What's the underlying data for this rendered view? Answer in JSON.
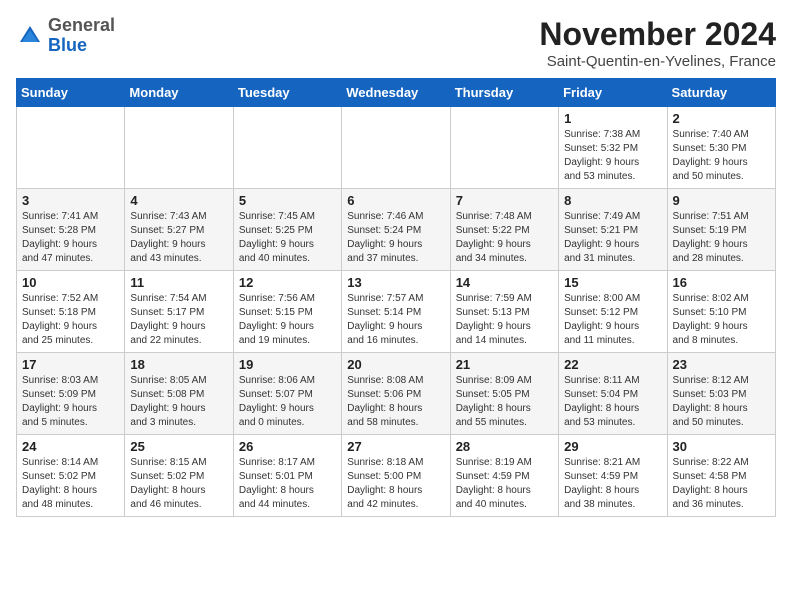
{
  "header": {
    "logo_general": "General",
    "logo_blue": "Blue",
    "month_year": "November 2024",
    "location": "Saint-Quentin-en-Yvelines, France"
  },
  "days_of_week": [
    "Sunday",
    "Monday",
    "Tuesday",
    "Wednesday",
    "Thursday",
    "Friday",
    "Saturday"
  ],
  "weeks": [
    [
      {
        "day": "",
        "info": ""
      },
      {
        "day": "",
        "info": ""
      },
      {
        "day": "",
        "info": ""
      },
      {
        "day": "",
        "info": ""
      },
      {
        "day": "",
        "info": ""
      },
      {
        "day": "1",
        "info": "Sunrise: 7:38 AM\nSunset: 5:32 PM\nDaylight: 9 hours\nand 53 minutes."
      },
      {
        "day": "2",
        "info": "Sunrise: 7:40 AM\nSunset: 5:30 PM\nDaylight: 9 hours\nand 50 minutes."
      }
    ],
    [
      {
        "day": "3",
        "info": "Sunrise: 7:41 AM\nSunset: 5:28 PM\nDaylight: 9 hours\nand 47 minutes."
      },
      {
        "day": "4",
        "info": "Sunrise: 7:43 AM\nSunset: 5:27 PM\nDaylight: 9 hours\nand 43 minutes."
      },
      {
        "day": "5",
        "info": "Sunrise: 7:45 AM\nSunset: 5:25 PM\nDaylight: 9 hours\nand 40 minutes."
      },
      {
        "day": "6",
        "info": "Sunrise: 7:46 AM\nSunset: 5:24 PM\nDaylight: 9 hours\nand 37 minutes."
      },
      {
        "day": "7",
        "info": "Sunrise: 7:48 AM\nSunset: 5:22 PM\nDaylight: 9 hours\nand 34 minutes."
      },
      {
        "day": "8",
        "info": "Sunrise: 7:49 AM\nSunset: 5:21 PM\nDaylight: 9 hours\nand 31 minutes."
      },
      {
        "day": "9",
        "info": "Sunrise: 7:51 AM\nSunset: 5:19 PM\nDaylight: 9 hours\nand 28 minutes."
      }
    ],
    [
      {
        "day": "10",
        "info": "Sunrise: 7:52 AM\nSunset: 5:18 PM\nDaylight: 9 hours\nand 25 minutes."
      },
      {
        "day": "11",
        "info": "Sunrise: 7:54 AM\nSunset: 5:17 PM\nDaylight: 9 hours\nand 22 minutes."
      },
      {
        "day": "12",
        "info": "Sunrise: 7:56 AM\nSunset: 5:15 PM\nDaylight: 9 hours\nand 19 minutes."
      },
      {
        "day": "13",
        "info": "Sunrise: 7:57 AM\nSunset: 5:14 PM\nDaylight: 9 hours\nand 16 minutes."
      },
      {
        "day": "14",
        "info": "Sunrise: 7:59 AM\nSunset: 5:13 PM\nDaylight: 9 hours\nand 14 minutes."
      },
      {
        "day": "15",
        "info": "Sunrise: 8:00 AM\nSunset: 5:12 PM\nDaylight: 9 hours\nand 11 minutes."
      },
      {
        "day": "16",
        "info": "Sunrise: 8:02 AM\nSunset: 5:10 PM\nDaylight: 9 hours\nand 8 minutes."
      }
    ],
    [
      {
        "day": "17",
        "info": "Sunrise: 8:03 AM\nSunset: 5:09 PM\nDaylight: 9 hours\nand 5 minutes."
      },
      {
        "day": "18",
        "info": "Sunrise: 8:05 AM\nSunset: 5:08 PM\nDaylight: 9 hours\nand 3 minutes."
      },
      {
        "day": "19",
        "info": "Sunrise: 8:06 AM\nSunset: 5:07 PM\nDaylight: 9 hours\nand 0 minutes."
      },
      {
        "day": "20",
        "info": "Sunrise: 8:08 AM\nSunset: 5:06 PM\nDaylight: 8 hours\nand 58 minutes."
      },
      {
        "day": "21",
        "info": "Sunrise: 8:09 AM\nSunset: 5:05 PM\nDaylight: 8 hours\nand 55 minutes."
      },
      {
        "day": "22",
        "info": "Sunrise: 8:11 AM\nSunset: 5:04 PM\nDaylight: 8 hours\nand 53 minutes."
      },
      {
        "day": "23",
        "info": "Sunrise: 8:12 AM\nSunset: 5:03 PM\nDaylight: 8 hours\nand 50 minutes."
      }
    ],
    [
      {
        "day": "24",
        "info": "Sunrise: 8:14 AM\nSunset: 5:02 PM\nDaylight: 8 hours\nand 48 minutes."
      },
      {
        "day": "25",
        "info": "Sunrise: 8:15 AM\nSunset: 5:02 PM\nDaylight: 8 hours\nand 46 minutes."
      },
      {
        "day": "26",
        "info": "Sunrise: 8:17 AM\nSunset: 5:01 PM\nDaylight: 8 hours\nand 44 minutes."
      },
      {
        "day": "27",
        "info": "Sunrise: 8:18 AM\nSunset: 5:00 PM\nDaylight: 8 hours\nand 42 minutes."
      },
      {
        "day": "28",
        "info": "Sunrise: 8:19 AM\nSunset: 4:59 PM\nDaylight: 8 hours\nand 40 minutes."
      },
      {
        "day": "29",
        "info": "Sunrise: 8:21 AM\nSunset: 4:59 PM\nDaylight: 8 hours\nand 38 minutes."
      },
      {
        "day": "30",
        "info": "Sunrise: 8:22 AM\nSunset: 4:58 PM\nDaylight: 8 hours\nand 36 minutes."
      }
    ]
  ]
}
